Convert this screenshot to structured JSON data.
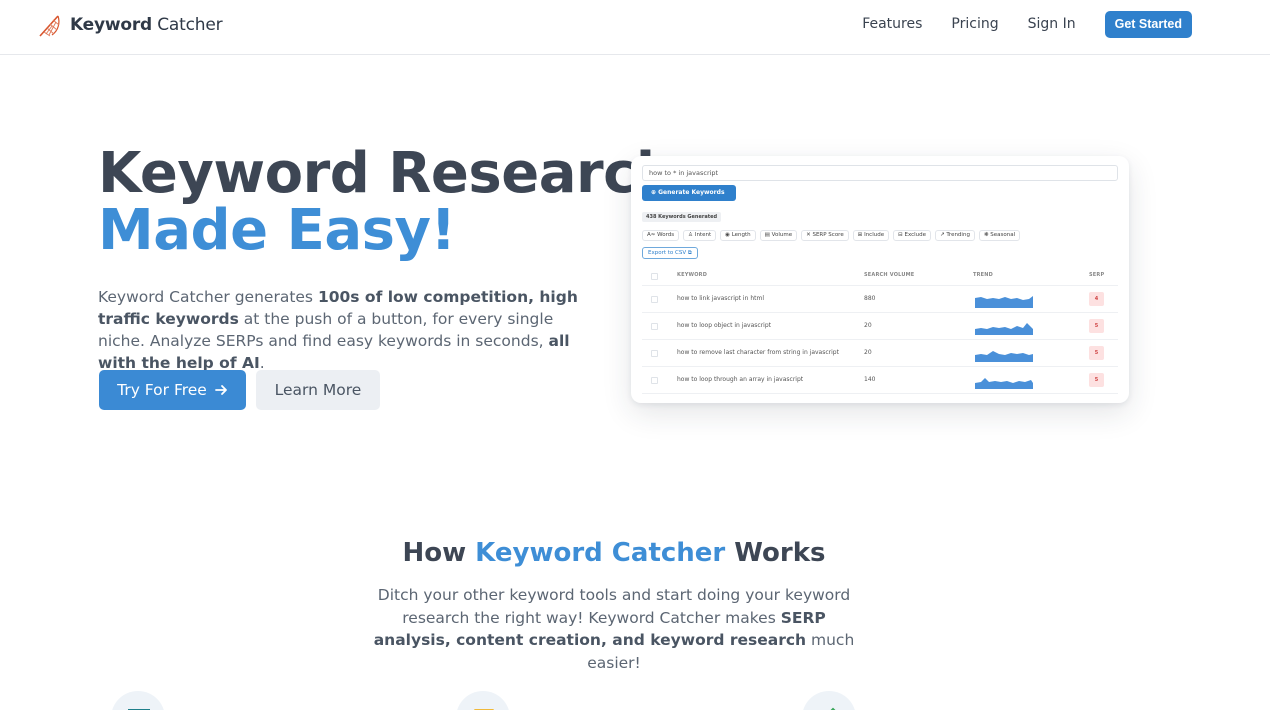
{
  "nav": {
    "brand_bold": "Keyword",
    "brand_light": "Catcher",
    "links": [
      "Features",
      "Pricing",
      "Sign In"
    ],
    "cta": "Get Started"
  },
  "hero": {
    "title_line1": "Keyword Research,",
    "title_line2": "Made Easy!",
    "desc_1": "Keyword Catcher generates ",
    "desc_bold_1": "100s of low competition, high traffic keywords",
    "desc_2": " at the push of a button, for every single niche. Analyze SERPs and find easy keywords in seconds, ",
    "desc_bold_2": "all with the help of AI",
    "desc_3": ".",
    "primary_button": "Try For Free",
    "secondary_button": "Learn More"
  },
  "preview": {
    "search_value": "how to * in javascript",
    "generate_button": "Generate Keywords",
    "count_badge": "438 Keywords Generated",
    "filters": [
      "Words",
      "Intent",
      "Length",
      "Volume",
      "SERP Score",
      "Include",
      "Exclude",
      "Trending",
      "Seasonal"
    ],
    "export_button": "Export to CSV",
    "columns": {
      "keyword": "KEYWORD",
      "volume": "SEARCH VOLUME",
      "trend": "TREND",
      "serp": "SERP"
    },
    "rows": [
      {
        "keyword": "how to link javascript in html",
        "volume": "880",
        "serp": "4"
      },
      {
        "keyword": "how to loop object in javascript",
        "volume": "20",
        "serp": "5"
      },
      {
        "keyword": "how to remove last character from string in javascript",
        "volume": "20",
        "serp": "5"
      },
      {
        "keyword": "how to loop through an array in javascript",
        "volume": "140",
        "serp": "5"
      }
    ]
  },
  "how": {
    "title_1": "How ",
    "title_accent": "Keyword Catcher",
    "title_2": " Works",
    "desc_1": "Ditch your other keyword tools and start doing your keyword research the right way! Keyword Catcher makes ",
    "desc_bold": "SERP analysis, content creation, and keyword research",
    "desc_2": " much easier!"
  },
  "colors": {
    "accent": "#2f80cc",
    "heading_blue": "#3e8ed6",
    "highlight": "#a9d6f7",
    "serp_badge": "#fde1e1"
  }
}
